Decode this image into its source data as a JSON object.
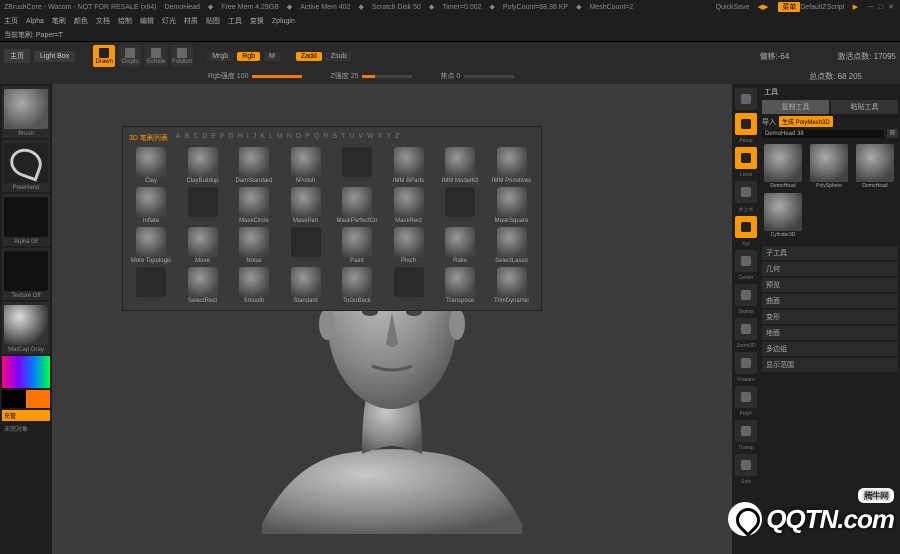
{
  "title": {
    "app": "ZBrushCore - Wacom - NOT FOR RESALE (x64)",
    "doc": "DemoHead",
    "mem_free": "Free Mem 4.29GB",
    "active_mem": "Active Mem 402",
    "scratch": "Scratch Disk 50",
    "timer": "Timer=0.002",
    "polycount": "PolyCount=68.38 KP",
    "meshcount": "MeshCount=2",
    "quicksave": "QuickSave",
    "menu_btn": "菜单",
    "script": "DefaultZScript"
  },
  "menubar": [
    "主页",
    "Alpha",
    "笔刷",
    "颜色",
    "文档",
    "绘制",
    "编辑",
    "灯光",
    "材质",
    "贴图",
    "工具",
    "变换",
    "Zplugin"
  ],
  "statusline": {
    "brush_label": "当前笔刷: Paper=T"
  },
  "toolbar": {
    "tabs": {
      "main": "主页",
      "lightbox": "Light Box"
    },
    "buttons": {
      "deawn": "Drawn",
      "displs": "Displs",
      "echele": "Echele",
      "foldton": "Foldton"
    },
    "modes": {
      "mrgb": "Mrgb",
      "rgb": "Rgb",
      "m": "M",
      "zadd": "Zadd",
      "zsub": "Zsub"
    },
    "sliders": {
      "rgb": {
        "label": "Rgb强度 100",
        "pct": 100
      },
      "z": {
        "label": "Z强度 25",
        "pct": 25
      },
      "focal": {
        "label": "焦点 0",
        "pct": 0
      }
    },
    "right": {
      "offset": "偏移:-64",
      "activepoints": "激活点数: 17095",
      "totalpoints": "总点数: 68 205"
    }
  },
  "left": {
    "brush": "Brush",
    "stroke": "FreeHand",
    "alpha": "Alpha 08",
    "texture": "Texture Off",
    "matcap": "MatCap Gray",
    "fill": "充管",
    "pending": "未完対象"
  },
  "palette": {
    "c1": "#000000",
    "c2": "#ff7700"
  },
  "brush_popup": {
    "title": "3D 笔刷列表",
    "letters": [
      "A",
      "B",
      "C",
      "D",
      "E",
      "F",
      "G",
      "H",
      "I",
      "J",
      "K",
      "L",
      "M",
      "N",
      "O",
      "P",
      "Q",
      "R",
      "S",
      "T",
      "U",
      "V",
      "W",
      "X",
      "Y",
      "Z"
    ],
    "brushes": [
      "Clay",
      "ClayBuildup",
      "DamStandard",
      "hPolish",
      "",
      "IMM BParts",
      "IMM ModelKit",
      "IMM Primitives",
      "Inflate",
      "",
      "MaskCircle",
      "MaskPen",
      "MaskPerfectCir",
      "MaskRect",
      "",
      "MaskSquare",
      "More Topologic",
      "Move",
      "Noise",
      "",
      "Paint",
      "Pinch",
      "Rake",
      "SelectLasso",
      "",
      "SelectRect",
      "Smooth",
      "Standard",
      "ToGoBack",
      "",
      "Transpose",
      "TrimDynamic"
    ]
  },
  "iconstrip": [
    {
      "name": "sphere-preview",
      "on": false,
      "label": ""
    },
    {
      "name": "persp",
      "on": true,
      "label": "Persp"
    },
    {
      "name": "local",
      "on": true,
      "label": "Local"
    },
    {
      "name": "sym-lr",
      "on": false,
      "label": "水上水"
    },
    {
      "name": "xyz",
      "on": true,
      "label": "Xyz"
    },
    {
      "name": "center",
      "on": false,
      "label": "Center"
    },
    {
      "name": "dsplas",
      "on": false,
      "label": "Dsplas"
    },
    {
      "name": "zoom3d",
      "on": false,
      "label": "Zoom3D"
    },
    {
      "name": "frame",
      "on": false,
      "label": "Fraaare"
    },
    {
      "name": "polyf",
      "on": false,
      "label": "PolyF"
    },
    {
      "name": "transp",
      "on": false,
      "label": "Transp"
    },
    {
      "name": "solo",
      "on": false,
      "label": "Solo"
    }
  ],
  "rightpanel": {
    "header": "工具",
    "tabs": {
      "load": "复制工具",
      "save": "粘贴工具"
    },
    "import": "导入",
    "generate_btn": "生成 PolyMesh3D",
    "current": {
      "name": "DemoHead",
      "value": "38",
      "r": "R"
    },
    "tools": [
      "DemoHead",
      "PolySphere",
      "DemoHead",
      "Cylinder3D"
    ],
    "sections": [
      "子工具",
      "几何",
      "预览",
      "曲面",
      "变形",
      "地面",
      "多边组",
      "显示范围"
    ]
  },
  "watermark": {
    "text": "QQTN.com",
    "cn": "腾牛网"
  }
}
